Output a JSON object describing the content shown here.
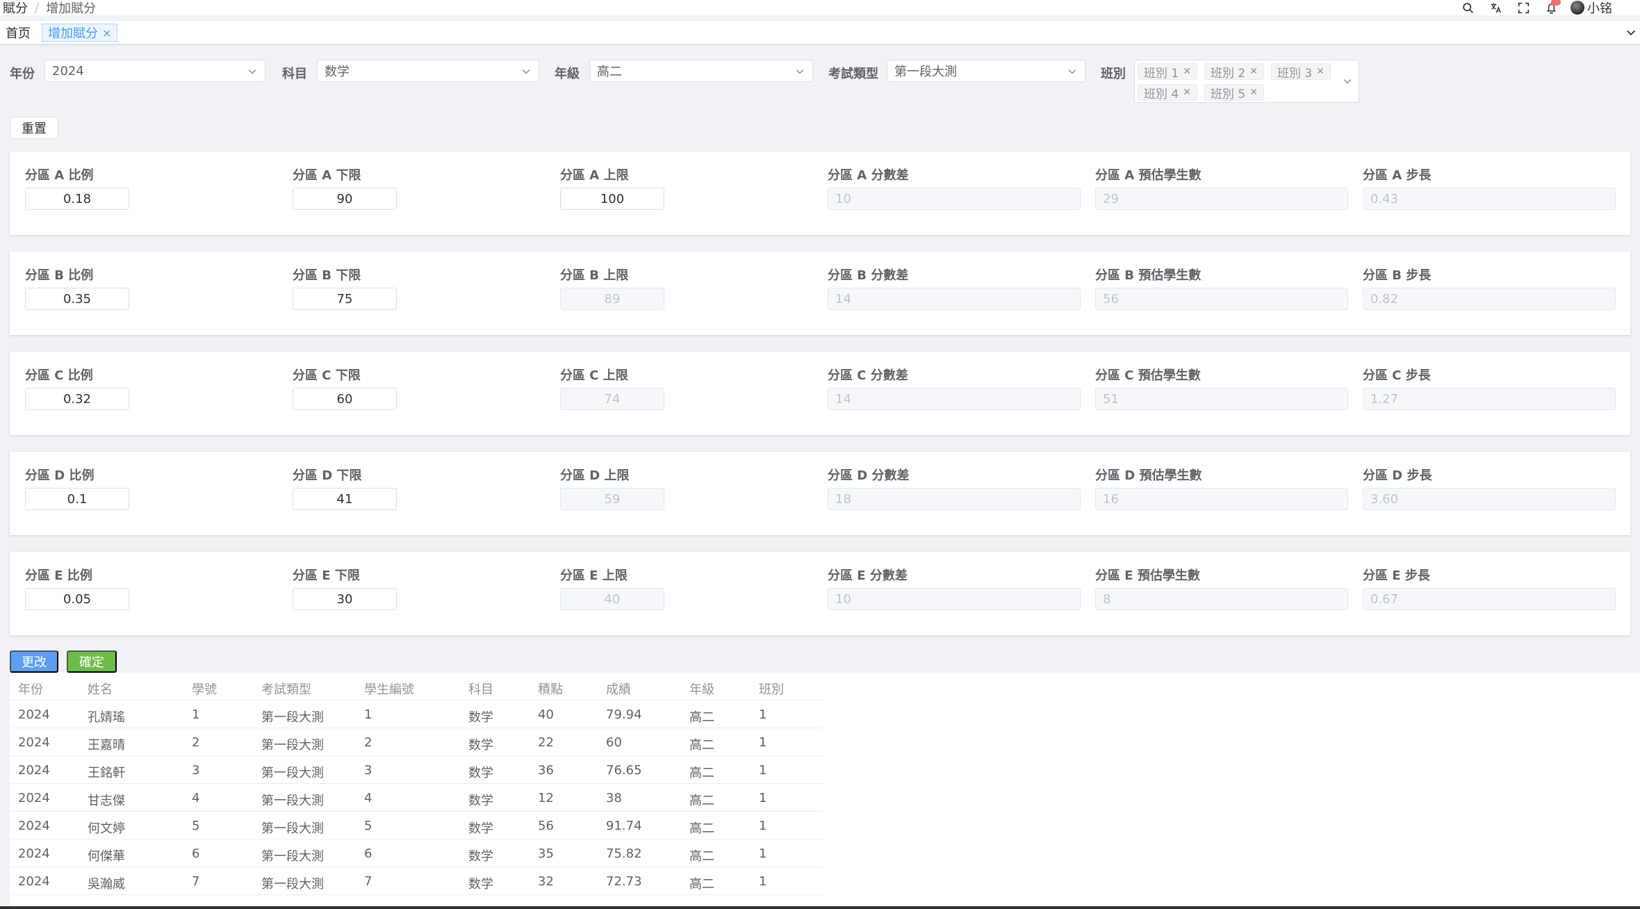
{
  "breadcrumb": {
    "root": "賦分",
    "separator": "/",
    "current": "增加賦分"
  },
  "user": {
    "name": "小铭"
  },
  "tags": {
    "home": "首页",
    "active": "增加賦分",
    "close": "×"
  },
  "filters": {
    "year": {
      "label": "年份",
      "value": "2024"
    },
    "subject": {
      "label": "科目",
      "value": "数学"
    },
    "grade": {
      "label": "年級",
      "value": "高二"
    },
    "exam_type": {
      "label": "考試類型",
      "value": "第一段大測"
    },
    "class": {
      "label": "班別",
      "chips": [
        "班別 1",
        "班別 2",
        "班別 3",
        "班別 4",
        "班別 5"
      ]
    }
  },
  "buttons": {
    "reset": "重置",
    "modify": "更改",
    "confirm": "確定"
  },
  "partitions": [
    {
      "labels": [
        "分區 A 比例",
        "分區 A 下限",
        "分區 A 上限",
        "分區 A 分數差",
        "分區 A 預估學生數",
        "分區 A 步長"
      ],
      "values": [
        "0.18",
        "90",
        "100",
        "10",
        "29",
        "0.43"
      ]
    },
    {
      "labels": [
        "分區 B 比例",
        "分區 B 下限",
        "分區 B 上限",
        "分區 B 分數差",
        "分區 B 預估學生數",
        "分區 B 步長"
      ],
      "values": [
        "0.35",
        "75",
        "89",
        "14",
        "56",
        "0.82"
      ]
    },
    {
      "labels": [
        "分區 C 比例",
        "分區 C 下限",
        "分區 C 上限",
        "分區 C 分數差",
        "分區 C 預估學生數",
        "分區 C 步長"
      ],
      "values": [
        "0.32",
        "60",
        "74",
        "14",
        "51",
        "1.27"
      ]
    },
    {
      "labels": [
        "分區 D 比例",
        "分區 D 下限",
        "分區 D 上限",
        "分區 D 分數差",
        "分區 D 預估學生數",
        "分區 D 步長"
      ],
      "values": [
        "0.1",
        "41",
        "59",
        "18",
        "16",
        "3.60"
      ]
    },
    {
      "labels": [
        "分區 E 比例",
        "分區 E 下限",
        "分區 E 上限",
        "分區 E 分數差",
        "分區 E 預估學生數",
        "分區 E 步長"
      ],
      "values": [
        "0.05",
        "30",
        "40",
        "10",
        "8",
        "0.67"
      ]
    }
  ],
  "table": {
    "headers": [
      "年份",
      "姓名",
      "學號",
      "考試類型",
      "學生編號",
      "科目",
      "積點",
      "成績",
      "年級",
      "班別"
    ],
    "rows": [
      [
        "2024",
        "孔婧瑤",
        "1",
        "第一段大測",
        "1",
        "数学",
        "40",
        "79.94",
        "高二",
        "1"
      ],
      [
        "2024",
        "王嘉晴",
        "2",
        "第一段大測",
        "2",
        "数学",
        "22",
        "60",
        "高二",
        "1"
      ],
      [
        "2024",
        "王銘軒",
        "3",
        "第一段大測",
        "3",
        "数学",
        "36",
        "76.65",
        "高二",
        "1"
      ],
      [
        "2024",
        "甘志傑",
        "4",
        "第一段大測",
        "4",
        "数学",
        "12",
        "38",
        "高二",
        "1"
      ],
      [
        "2024",
        "何文婷",
        "5",
        "第一段大測",
        "5",
        "数学",
        "56",
        "91.74",
        "高二",
        "1"
      ],
      [
        "2024",
        "何傑華",
        "6",
        "第一段大測",
        "6",
        "数学",
        "35",
        "75.82",
        "高二",
        "1"
      ],
      [
        "2024",
        "吳瀚威",
        "7",
        "第一段大測",
        "7",
        "数学",
        "32",
        "72.73",
        "高二",
        "1"
      ]
    ]
  },
  "colors": {
    "primary": "#409eff",
    "success": "#6cbd45",
    "background": "#f0f2f5"
  },
  "icons": [
    "search-icon",
    "translate-icon",
    "fullscreen-icon",
    "bell-icon",
    "avatar",
    "chevron-down-icon",
    "close-icon"
  ]
}
